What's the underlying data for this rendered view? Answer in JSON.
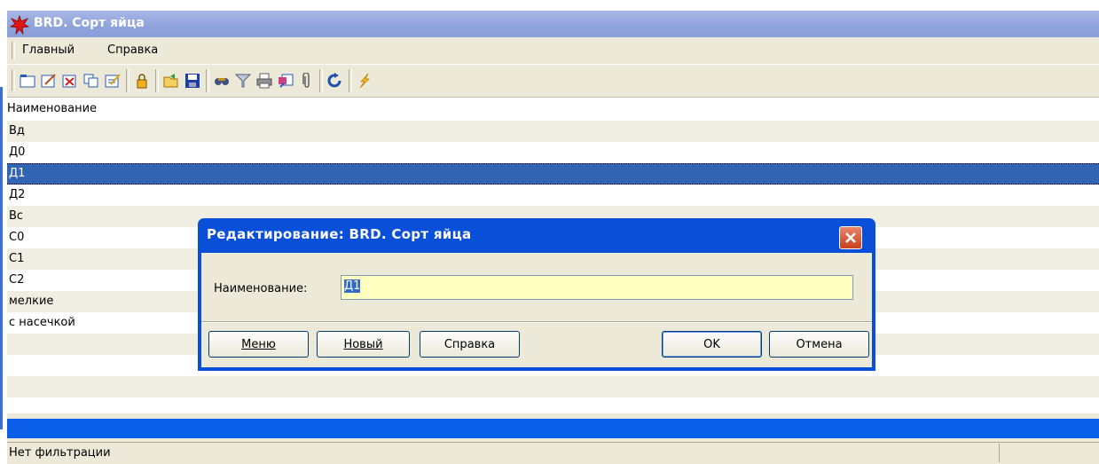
{
  "window": {
    "title": "BRD. Сорт яйца",
    "app_icon": "red-star-icon"
  },
  "menu": {
    "items": [
      "Главный",
      "Справка"
    ]
  },
  "toolbar": {
    "buttons": [
      "folder-icon",
      "edit-icon",
      "delete-icon",
      "copy-icon",
      "edit-multiple-icon",
      "lock-icon",
      "open-folder-icon",
      "save-icon",
      "find-icon",
      "filter-icon",
      "print-icon",
      "export-icon",
      "attach-icon",
      "refresh-icon",
      "lightning-icon"
    ]
  },
  "grid": {
    "header": "Наименование",
    "rows": [
      "Вд",
      "Д0",
      "Д1",
      "Д2",
      "Вс",
      "С0",
      "С1",
      "С2",
      "мелкие",
      "с насечкой"
    ],
    "selected_index": 2
  },
  "status": {
    "text": "Нет фильтрации"
  },
  "dialog": {
    "title": "Редактирование: BRD. Сорт яйца",
    "field_label": "Наименование:",
    "field_value": "Д1",
    "buttons": {
      "menu": "Меню",
      "new": "Новый",
      "help": "Справка",
      "ok": "OK",
      "cancel": "Отмена"
    }
  },
  "colors": {
    "selection": "#3165b4",
    "titlebar": "#8fa2db",
    "dialog_frame": "#0a4fd8",
    "input_bg": "#ffffc0"
  }
}
